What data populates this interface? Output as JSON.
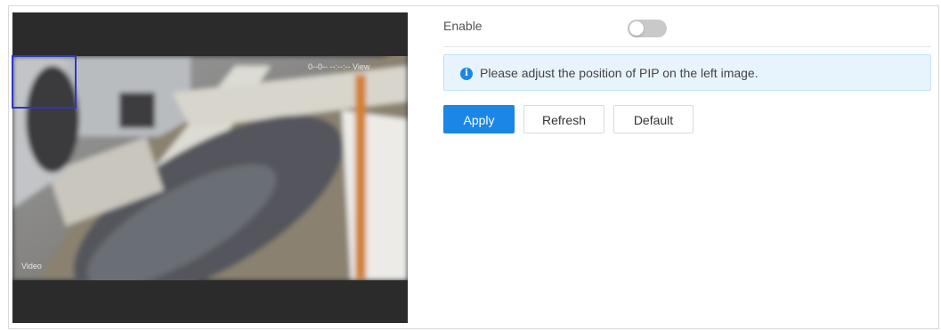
{
  "video_preview": {
    "overlay_timestamp": "0‑‑0‑‑ ‑‑:‑‑:‑‑ View",
    "overlay_channel": "Video"
  },
  "settings": {
    "enable_label": "Enable",
    "enable_state": false
  },
  "info": {
    "icon": "info-circle-icon",
    "icon_glyph": "i",
    "message": "Please adjust the position of PIP on the left image."
  },
  "buttons": {
    "apply": "Apply",
    "refresh": "Refresh",
    "default": "Default"
  },
  "colors": {
    "accent": "#1b86e6",
    "pip_box": "#2b37c9",
    "info_background": "#e8f4fd"
  }
}
